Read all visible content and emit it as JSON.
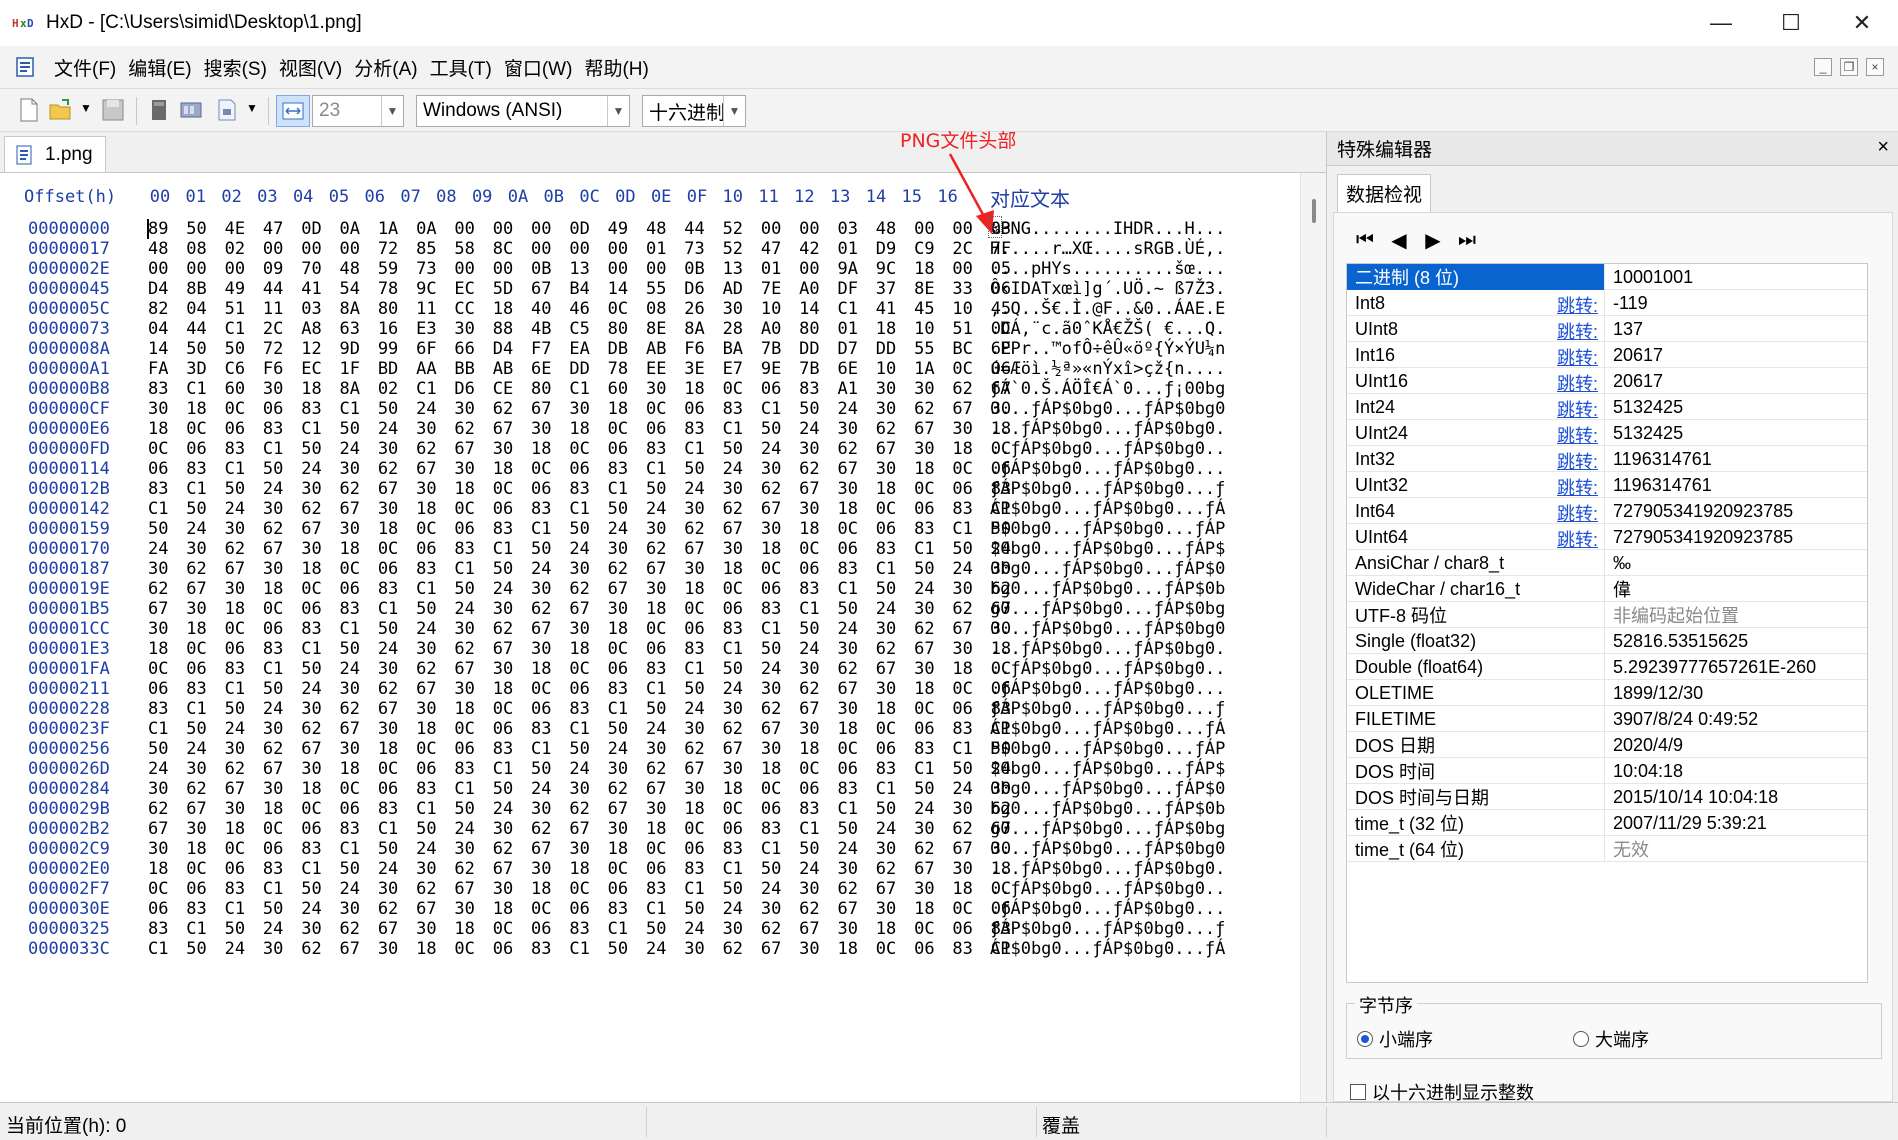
{
  "window": {
    "title": "HxD - [C:\\Users\\simid\\Desktop\\1.png]",
    "minimize_glyph": "—",
    "maximize_glyph": "☐",
    "close_glyph": "✕"
  },
  "menu": [
    "文件(F)",
    "编辑(E)",
    "搜索(S)",
    "视图(V)",
    "分析(A)",
    "工具(T)",
    "窗口(W)",
    "帮助(H)"
  ],
  "toolbar": {
    "bytes_per_row": "23",
    "encoding": "Windows (ANSI)",
    "offset_base": "十六进制"
  },
  "tab": {
    "label": "1.png"
  },
  "annotation": {
    "label": "PNG文件头部"
  },
  "hex": {
    "offset_header": "Offset(h)",
    "columns": [
      "00",
      "01",
      "02",
      "03",
      "04",
      "05",
      "06",
      "07",
      "08",
      "09",
      "0A",
      "0B",
      "0C",
      "0D",
      "0E",
      "0F",
      "10",
      "11",
      "12",
      "13",
      "14",
      "15",
      "16"
    ],
    "text_header": "对应文本",
    "rows": [
      {
        "offset": "00000000",
        "bytes": "89 50 4E 47 0D 0A 1A 0A 00 00 00 0D 49 48 44 52 00 00 03 48 00 00 03",
        "ascii": "‰PNG........IHDR...H..."
      },
      {
        "offset": "00000017",
        "bytes": "48 08 02 00 00 00 72 85 58 8C 00 00 00 01 73 52 47 42 01 D9 C9 2C 7F",
        "ascii": "H.....r…XŒ....sRGB.ÙÉ,."
      },
      {
        "offset": "0000002E",
        "bytes": "00 00 00 09 70 48 59 73 00 00 0B 13 00 00 0B 13 01 00 9A 9C 18 00 05",
        "ascii": "....pHYs..........šœ..."
      },
      {
        "offset": "00000045",
        "bytes": "D4 8B 49 44 41 54 78 9C EC 5D 67 B4 14 55 D6 AD 7E A0 DF 37 8E 33 06",
        "ascii": "Ô‹IDATxœì]g´.UÖ.~ ß7Ž3."
      },
      {
        "offset": "0000005C",
        "bytes": "82 04 51 11 03 8A 80 11 CC 18 40 46 0C 08 26 30 10 14 C1 41 45 10 45",
        "ascii": "‚.Q..Š€.Ì.@F..&0..ÁAE.E"
      },
      {
        "offset": "00000073",
        "bytes": "04 44 C1 2C A8 63 16 E3 30 88 4B C5 80 8E 8A 28 A0 80 01 18 10 51 0C",
        "ascii": ".DÁ,¨c.ã0ˆKÅ€ŽŠ( €...Q."
      },
      {
        "offset": "0000008A",
        "bytes": "14 50 50 72 12 9D 99 6F 66 D4 F7 EA DB AB F6 BA 7B DD D7 DD 55 BC 6E",
        "ascii": ".PPr..™ofÔ÷êÛ«öº{Ý×ÝU¼n"
      },
      {
        "offset": "000000A1",
        "bytes": "FA 3D C6 F6 EC 1F BD AA BB AB 6E DD 78 EE 3E E7 9E 7B 6E 10 1A 0C 06",
        "ascii": "ú=Æöì.½ª»«nÝxî>çž{n...."
      },
      {
        "offset": "000000B8",
        "bytes": "83 C1 60 30 18 8A 02 C1 D6 CE 80 C1 60 30 18 0C 06 83 A1 30 30 62 67",
        "ascii": "ƒÁ`0.Š.ÁÖÎ€Á`0...ƒ¡00bg"
      },
      {
        "offset": "000000CF",
        "bytes": "30 18 0C 06 83 C1 50 24 30 62 67 30 18 0C 06 83 C1 50 24 30 62 67 30",
        "ascii": "0...ƒÁP$0bg0...ƒÁP$0bg0"
      },
      {
        "offset": "000000E6",
        "bytes": "18 0C 06 83 C1 50 24 30 62 67 30 18 0C 06 83 C1 50 24 30 62 67 30 18",
        "ascii": "...ƒÁP$0bg0...ƒÁP$0bg0."
      },
      {
        "offset": "000000FD",
        "bytes": "0C 06 83 C1 50 24 30 62 67 30 18 0C 06 83 C1 50 24 30 62 67 30 18 0C",
        "ascii": "..ƒÁP$0bg0...ƒÁP$0bg0.."
      },
      {
        "offset": "00000114",
        "bytes": "06 83 C1 50 24 30 62 67 30 18 0C 06 83 C1 50 24 30 62 67 30 18 0C 06",
        "ascii": ".ƒÁP$0bg0...ƒÁP$0bg0..."
      },
      {
        "offset": "0000012B",
        "bytes": "83 C1 50 24 30 62 67 30 18 0C 06 83 C1 50 24 30 62 67 30 18 0C 06 83",
        "ascii": "ƒÁP$0bg0...ƒÁP$0bg0...ƒ"
      },
      {
        "offset": "00000142",
        "bytes": "C1 50 24 30 62 67 30 18 0C 06 83 C1 50 24 30 62 67 30 18 0C 06 83 C1",
        "ascii": "ÁP$0bg0...ƒÁP$0bg0...ƒÁ"
      },
      {
        "offset": "00000159",
        "bytes": "50 24 30 62 67 30 18 0C 06 83 C1 50 24 30 62 67 30 18 0C 06 83 C1 50",
        "ascii": "P$0bg0...ƒÁP$0bg0...ƒÁP"
      },
      {
        "offset": "00000170",
        "bytes": "24 30 62 67 30 18 0C 06 83 C1 50 24 30 62 67 30 18 0C 06 83 C1 50 24",
        "ascii": "$0bg0...ƒÁP$0bg0...ƒÁP$"
      },
      {
        "offset": "00000187",
        "bytes": "30 62 67 30 18 0C 06 83 C1 50 24 30 62 67 30 18 0C 06 83 C1 50 24 30",
        "ascii": "0bg0...ƒÁP$0bg0...ƒÁP$0"
      },
      {
        "offset": "0000019E",
        "bytes": "62 67 30 18 0C 06 83 C1 50 24 30 62 67 30 18 0C 06 83 C1 50 24 30 62",
        "ascii": "bg0...ƒÁP$0bg0...ƒÁP$0b"
      },
      {
        "offset": "000001B5",
        "bytes": "67 30 18 0C 06 83 C1 50 24 30 62 67 30 18 0C 06 83 C1 50 24 30 62 67",
        "ascii": "g0...ƒÁP$0bg0...ƒÁP$0bg"
      },
      {
        "offset": "000001CC",
        "bytes": "30 18 0C 06 83 C1 50 24 30 62 67 30 18 0C 06 83 C1 50 24 30 62 67 30",
        "ascii": "0...ƒÁP$0bg0...ƒÁP$0bg0"
      },
      {
        "offset": "000001E3",
        "bytes": "18 0C 06 83 C1 50 24 30 62 67 30 18 0C 06 83 C1 50 24 30 62 67 30 18",
        "ascii": "...ƒÁP$0bg0...ƒÁP$0bg0."
      },
      {
        "offset": "000001FA",
        "bytes": "0C 06 83 C1 50 24 30 62 67 30 18 0C 06 83 C1 50 24 30 62 67 30 18 0C",
        "ascii": "..ƒÁP$0bg0...ƒÁP$0bg0.."
      },
      {
        "offset": "00000211",
        "bytes": "06 83 C1 50 24 30 62 67 30 18 0C 06 83 C1 50 24 30 62 67 30 18 0C 06",
        "ascii": ".ƒÁP$0bg0...ƒÁP$0bg0..."
      },
      {
        "offset": "00000228",
        "bytes": "83 C1 50 24 30 62 67 30 18 0C 06 83 C1 50 24 30 62 67 30 18 0C 06 83",
        "ascii": "ƒÁP$0bg0...ƒÁP$0bg0...ƒ"
      },
      {
        "offset": "0000023F",
        "bytes": "C1 50 24 30 62 67 30 18 0C 06 83 C1 50 24 30 62 67 30 18 0C 06 83 C1",
        "ascii": "ÁP$0bg0...ƒÁP$0bg0...ƒÁ"
      },
      {
        "offset": "00000256",
        "bytes": "50 24 30 62 67 30 18 0C 06 83 C1 50 24 30 62 67 30 18 0C 06 83 C1 50",
        "ascii": "P$0bg0...ƒÁP$0bg0...ƒÁP"
      },
      {
        "offset": "0000026D",
        "bytes": "24 30 62 67 30 18 0C 06 83 C1 50 24 30 62 67 30 18 0C 06 83 C1 50 24",
        "ascii": "$0bg0...ƒÁP$0bg0...ƒÁP$"
      },
      {
        "offset": "00000284",
        "bytes": "30 62 67 30 18 0C 06 83 C1 50 24 30 62 67 30 18 0C 06 83 C1 50 24 30",
        "ascii": "0bg0...ƒÁP$0bg0...ƒÁP$0"
      },
      {
        "offset": "0000029B",
        "bytes": "62 67 30 18 0C 06 83 C1 50 24 30 62 67 30 18 0C 06 83 C1 50 24 30 62",
        "ascii": "bg0...ƒÁP$0bg0...ƒÁP$0b"
      },
      {
        "offset": "000002B2",
        "bytes": "67 30 18 0C 06 83 C1 50 24 30 62 67 30 18 0C 06 83 C1 50 24 30 62 67",
        "ascii": "g0...ƒÁP$0bg0...ƒÁP$0bg"
      },
      {
        "offset": "000002C9",
        "bytes": "30 18 0C 06 83 C1 50 24 30 62 67 30 18 0C 06 83 C1 50 24 30 62 67 30",
        "ascii": "0...ƒÁP$0bg0...ƒÁP$0bg0"
      },
      {
        "offset": "000002E0",
        "bytes": "18 0C 06 83 C1 50 24 30 62 67 30 18 0C 06 83 C1 50 24 30 62 67 30 18",
        "ascii": "...ƒÁP$0bg0...ƒÁP$0bg0."
      },
      {
        "offset": "000002F7",
        "bytes": "0C 06 83 C1 50 24 30 62 67 30 18 0C 06 83 C1 50 24 30 62 67 30 18 0C",
        "ascii": "..ƒÁP$0bg0...ƒÁP$0bg0.."
      },
      {
        "offset": "0000030E",
        "bytes": "06 83 C1 50 24 30 62 67 30 18 0C 06 83 C1 50 24 30 62 67 30 18 0C 06",
        "ascii": ".ƒÁP$0bg0...ƒÁP$0bg0..."
      },
      {
        "offset": "00000325",
        "bytes": "83 C1 50 24 30 62 67 30 18 0C 06 83 C1 50 24 30 62 67 30 18 0C 06 83",
        "ascii": "ƒÁP$0bg0...ƒÁP$0bg0...ƒ"
      },
      {
        "offset": "0000033C",
        "bytes": "C1 50 24 30 62 67 30 18 0C 06 83 C1 50 24 30 62 67 30 18 0C 06 83 C1",
        "ascii": "ÁP$0bg0...ƒÁP$0bg0...ƒÁ"
      }
    ]
  },
  "panel": {
    "title": "特殊编辑器",
    "close_glyph": "×",
    "tab": "数据检视",
    "jump_label": "跳转:",
    "rows": [
      {
        "name": "二进制 (8 位)",
        "value": "10001001",
        "jump": false,
        "selected": true
      },
      {
        "name": "Int8",
        "value": "-119",
        "jump": true
      },
      {
        "name": "UInt8",
        "value": "137",
        "jump": true
      },
      {
        "name": "Int16",
        "value": "20617",
        "jump": true
      },
      {
        "name": "UInt16",
        "value": "20617",
        "jump": true
      },
      {
        "name": "Int24",
        "value": "5132425",
        "jump": true
      },
      {
        "name": "UInt24",
        "value": "5132425",
        "jump": true
      },
      {
        "name": "Int32",
        "value": "1196314761",
        "jump": true
      },
      {
        "name": "UInt32",
        "value": "1196314761",
        "jump": true
      },
      {
        "name": "Int64",
        "value": "727905341920923785",
        "jump": true
      },
      {
        "name": "UInt64",
        "value": "727905341920923785",
        "jump": true
      },
      {
        "name": "AnsiChar / char8_t",
        "value": "‰",
        "jump": false
      },
      {
        "name": "WideChar / char16_t",
        "value": "偉",
        "jump": false
      },
      {
        "name": "UTF-8 码位",
        "value": "非编码起始位置",
        "jump": false,
        "gray": true
      },
      {
        "name": "Single (float32)",
        "value": "52816.53515625",
        "jump": false
      },
      {
        "name": "Double (float64)",
        "value": "5.29239777657261E-260",
        "jump": false
      },
      {
        "name": "OLETIME",
        "value": "1899/12/30",
        "jump": false
      },
      {
        "name": "FILETIME",
        "value": "3907/8/24 0:49:52",
        "jump": false
      },
      {
        "name": "DOS 日期",
        "value": "2020/4/9",
        "jump": false
      },
      {
        "name": "DOS 时间",
        "value": "10:04:18",
        "jump": false
      },
      {
        "name": "DOS 时间与日期",
        "value": "2015/10/14 10:04:18",
        "jump": false
      },
      {
        "name": "time_t (32 位)",
        "value": "2007/11/29 5:39:21",
        "jump": false
      },
      {
        "name": "time_t (64 位)",
        "value": "无效",
        "jump": false,
        "gray": true
      }
    ],
    "byte_order": {
      "legend": "字节序",
      "little": "小端序",
      "big": "大端序",
      "selected": "little"
    },
    "hex_ints_label": "以十六进制显示整数"
  },
  "status": {
    "position": "当前位置(h): 0",
    "mode": "覆盖"
  }
}
